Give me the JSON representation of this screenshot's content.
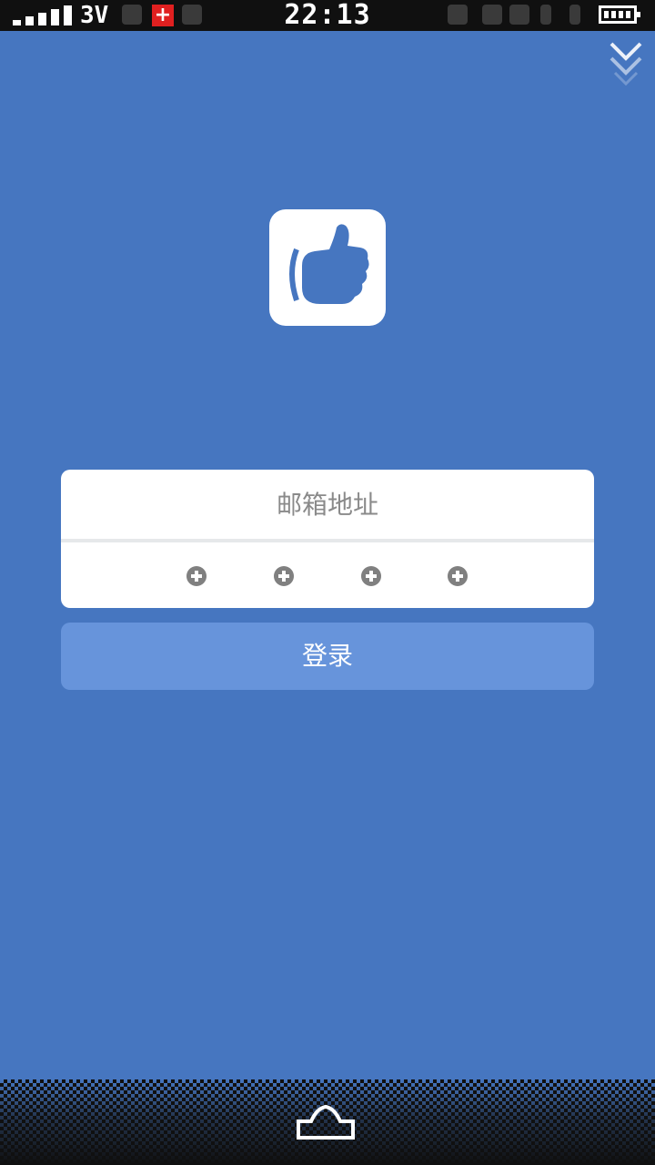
{
  "status_bar": {
    "network": "3V",
    "notification_icon": "plus-icon",
    "time": "22:13"
  },
  "colors": {
    "background": "#4676c0",
    "card": "#ffffff",
    "button": "#6794db",
    "status_bar": "#101010"
  },
  "logo": {
    "icon": "thumbs-up-icon"
  },
  "login_form": {
    "email_placeholder": "邮箱地址",
    "email_value": "",
    "pin_length": 4,
    "login_label": "登录"
  },
  "nav": {
    "collapse_icon": "double-chevron-down-icon",
    "home_icon": "home-icon"
  }
}
